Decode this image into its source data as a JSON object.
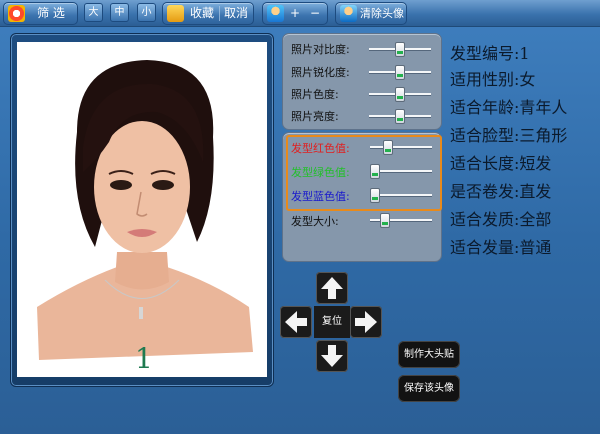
{
  "toolbar": {
    "filter_label": "筛 选",
    "size_large": "大",
    "size_medium": "中",
    "size_small": "小",
    "favorite_label": "收藏",
    "cancel_label": "取消",
    "zoom_in": "+",
    "zoom_out": "−",
    "clear_label": "清除头像"
  },
  "photo": {
    "number": "1"
  },
  "adjust_panel": {
    "contrast_label": "照片对比度:",
    "sharpness_label": "照片锐化度:",
    "hue_label": "照片色度:",
    "brightness_label": "照片亮度:",
    "contrast_value": 0.5,
    "sharpness_value": 0.5,
    "hue_value": 0.5,
    "brightness_value": 0.5
  },
  "hair_panel": {
    "red_label": "发型红色值:",
    "green_label": "发型绿色值:",
    "blue_label": "发型蓝色值:",
    "size_label": "发型大小:",
    "red_value": 0.25,
    "green_value": 0.0,
    "blue_value": 0.0,
    "size_value": 0.2,
    "red_color": "#e02020",
    "green_color": "#22c02a",
    "blue_color": "#1a1acc"
  },
  "info": {
    "number": "发型编号:1",
    "gender": "适用性别:女",
    "age": "适合年龄:青年人",
    "face": "适合脸型:三角形",
    "length": "适合长度:短发",
    "curl": "是否卷发:直发",
    "quality": "适合发质:全部",
    "volume": "适合发量:普通"
  },
  "controls": {
    "reset_label": "复位",
    "make_sticker_label": "制作大头贴",
    "save_avatar_label": "保存该头像"
  }
}
